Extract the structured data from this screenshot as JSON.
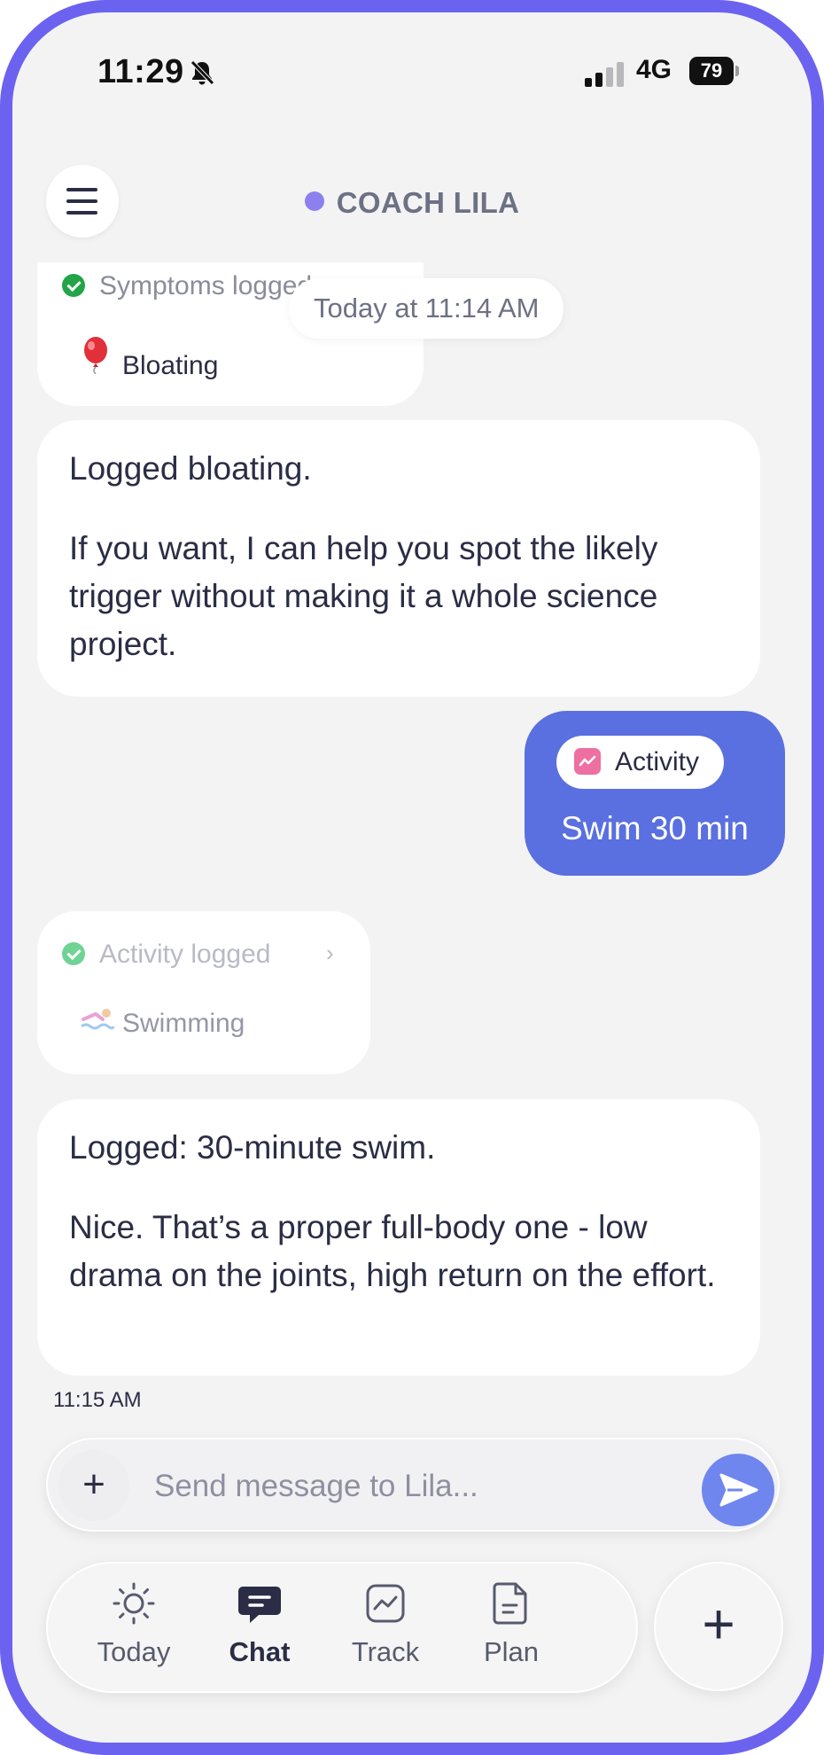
{
  "status_bar": {
    "time": "11:29",
    "network": "4G",
    "battery": "79"
  },
  "header": {
    "title": "COACH LILA"
  },
  "chat": {
    "symptoms_card": {
      "status": "Symptoms logged",
      "item": "Bloating",
      "item_icon": "balloon-icon"
    },
    "timestamp_pill": "Today at 11:14 AM",
    "coach_message_1": {
      "p1": "Logged bloating.",
      "p2": "If you want, I can help you spot the likely trigger without making it a whole science project."
    },
    "user_message": {
      "chip": "Activity",
      "text": "Swim 30 min"
    },
    "activity_card": {
      "status": "Activity logged",
      "item": "Swimming",
      "item_icon": "swimmer-icon"
    },
    "coach_message_2": {
      "p1": "Logged: 30-minute swim.",
      "p2": "Nice. That’s a proper full-body one - low drama on the joints, high return on the effort."
    },
    "last_time": "11:15 AM"
  },
  "composer": {
    "placeholder": "Send message to Lila..."
  },
  "tabs": [
    {
      "label": "Today",
      "icon": "sun-icon"
    },
    {
      "label": "Chat",
      "icon": "chat-icon",
      "active": true
    },
    {
      "label": "Track",
      "icon": "chart-icon"
    },
    {
      "label": "Plan",
      "icon": "document-icon"
    }
  ],
  "colors": {
    "accent": "#6b63f0",
    "user_bubble": "#5a6fe0",
    "check_green": "#22a447"
  }
}
